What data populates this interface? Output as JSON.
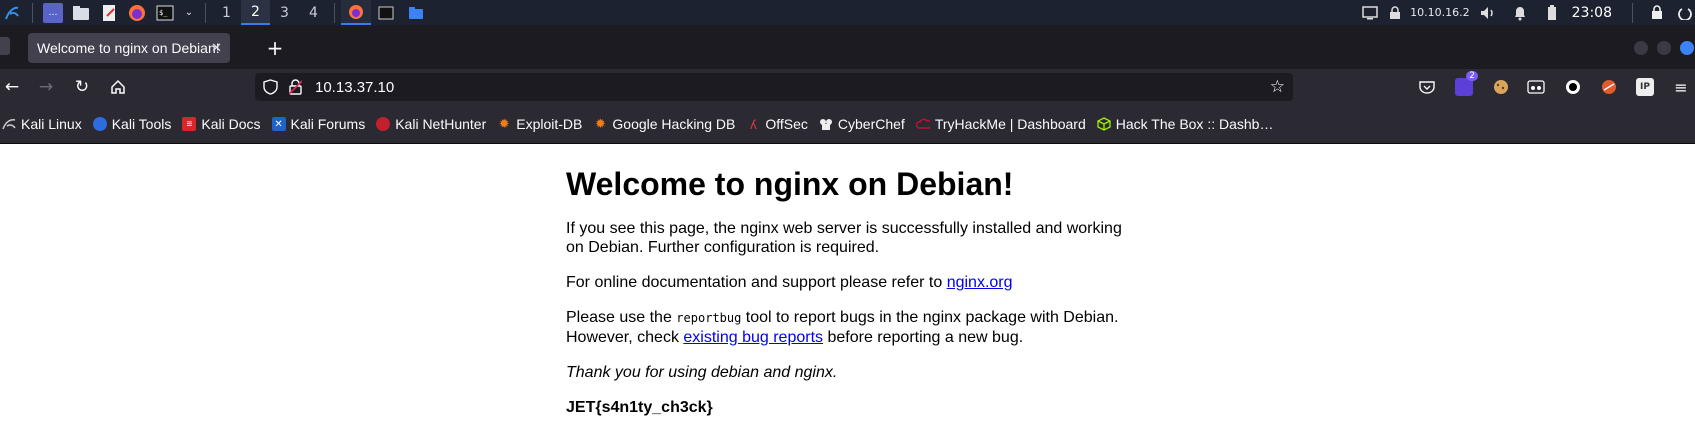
{
  "taskbar": {
    "workspaces": [
      "1",
      "2",
      "3",
      "4"
    ],
    "active_workspace": "2",
    "ip": "10.10.16.2",
    "clock": "23:08"
  },
  "browser": {
    "tab_title": "Welcome to nginx on Debian!",
    "tab_close": "✕",
    "new_tab": "+",
    "url": "10.13.37.10",
    "extension_badge": "2",
    "bookmarks": [
      "Kali Linux",
      "Kali Tools",
      "Kali Docs",
      "Kali Forums",
      "Kali NetHunter",
      "Exploit-DB",
      "Google Hacking DB",
      "OffSec",
      "CyberChef",
      "TryHackMe | Dashboard",
      "Hack The Box :: Dashb…"
    ]
  },
  "page": {
    "heading": "Welcome to nginx on Debian!",
    "p1": "If you see this page, the nginx web server is successfully installed and working on Debian. Further configuration is required.",
    "p2_text": "For online documentation and support please refer to ",
    "p2_link": "nginx.org",
    "p3_a": "Please use the ",
    "p3_code": "reportbug",
    "p3_b": " tool to report bugs in the nginx package with Debian. However, check ",
    "p3_link": "existing bug reports",
    "p3_c": " before reporting a new bug.",
    "p4": "Thank you for using debian and nginx.",
    "flag": "JET{s4n1ty_ch3ck}"
  },
  "colors": {
    "taskbar_bg": "#1d2230",
    "accent": "#367bf0",
    "firefox_chrome": "#2b2a33",
    "link": "#0000ee"
  }
}
